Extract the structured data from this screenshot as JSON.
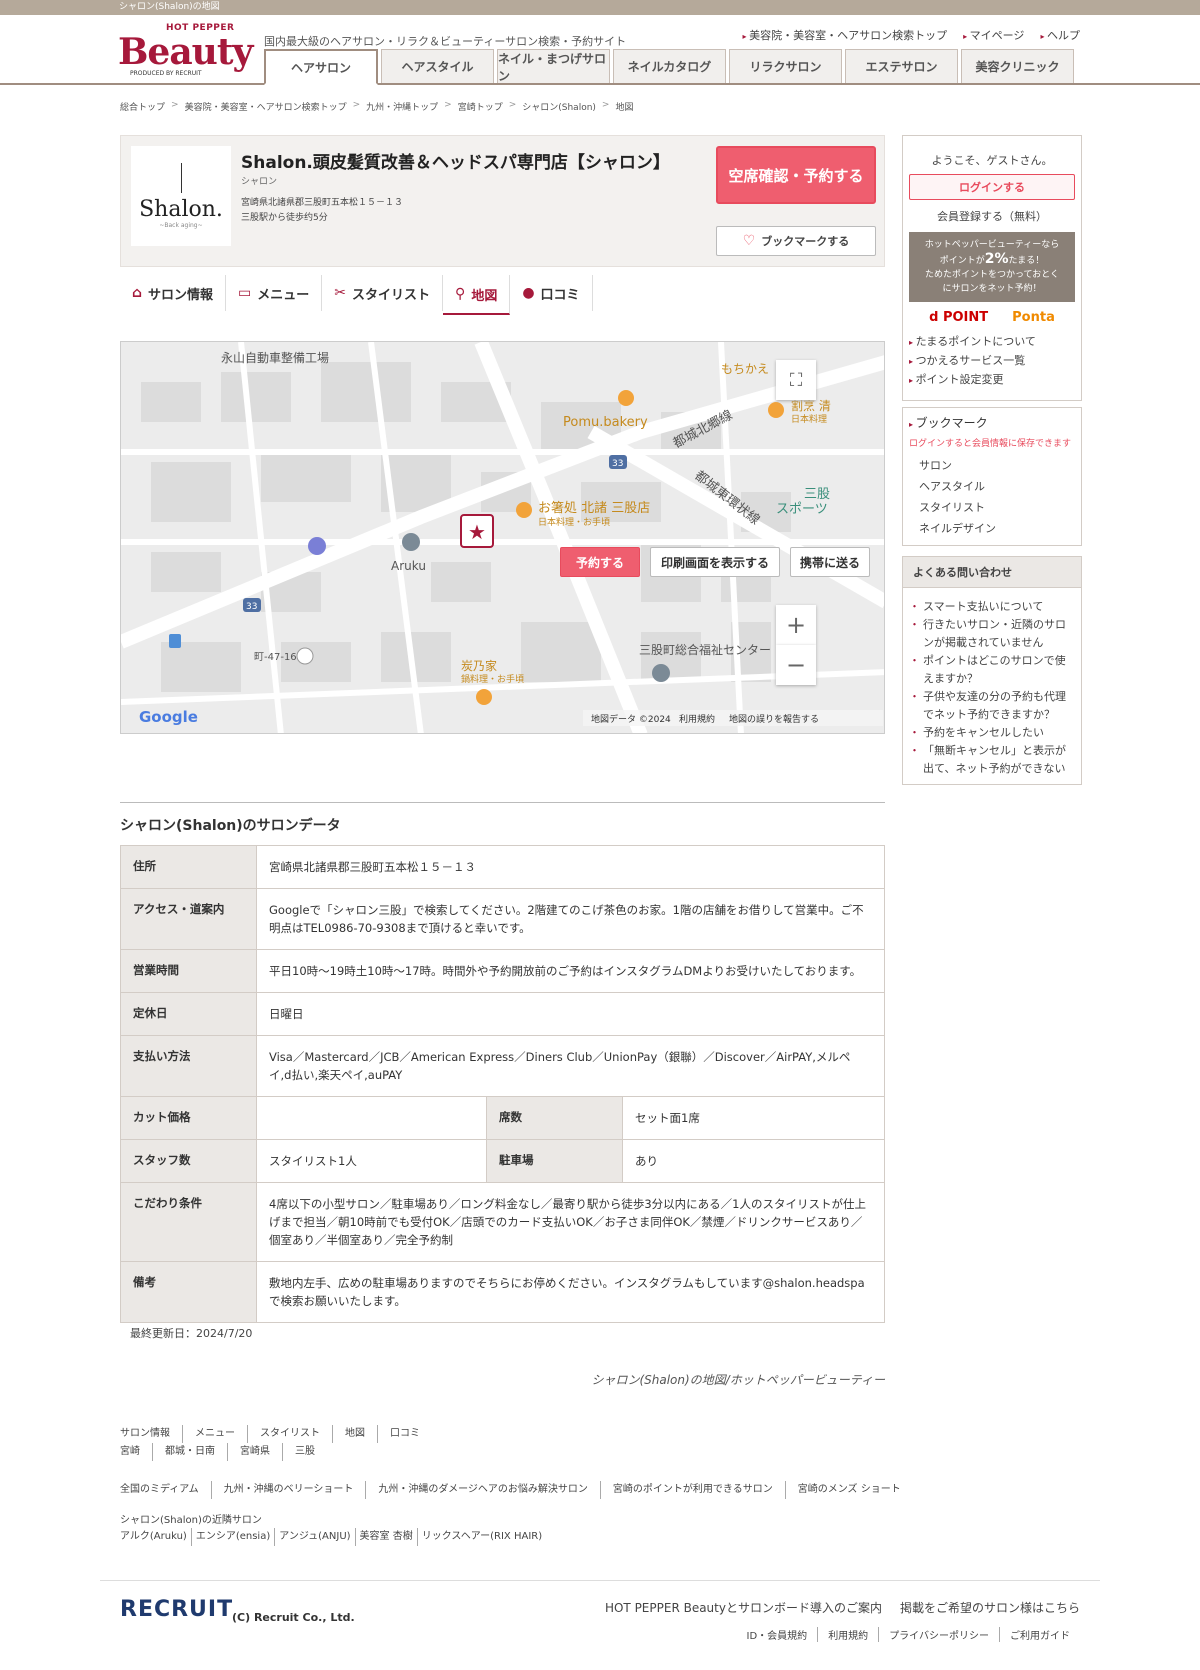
{
  "topbar": {
    "text": "シャロン(Shalon)の地図"
  },
  "header": {
    "logo_top": "HOT PEPPER",
    "logo_main": "Beauty",
    "logo_sub": "PRODUCED BY RECRUIT",
    "tagline": "国内最大級のヘアサロン・リラク＆ビューティーサロン検索・予約サイト",
    "links": [
      "美容院・美容室・ヘアサロン検索トップ",
      "マイページ",
      "ヘルプ"
    ],
    "tabs": [
      "ヘアサロン",
      "ヘアスタイル",
      "ネイル・まつげサロン",
      "ネイルカタログ",
      "リラクサロン",
      "エステサロン",
      "美容クリニック"
    ]
  },
  "breadcrumb": [
    "総合トップ",
    "美容院・美容室・ヘアサロン検索トップ",
    "九州・沖縄トップ",
    "宮崎トップ",
    "シャロン(Shalon)",
    "地図"
  ],
  "salon": {
    "logo_name": "Shalon.",
    "logo_sub": "~Back aging~",
    "name": "Shalon.頭皮髪質改善＆ヘッドスパ専門店【シャロン】",
    "kana": "シャロン",
    "address": "宮崎県北諸県郡三股町五本松１５－１３",
    "access": "三股駅から徒歩约5分",
    "reserve_btn": "空席確認・予約する",
    "bookmark_btn": "ブックマークする"
  },
  "subnav": [
    "サロン情報",
    "メニュー",
    "スタイリスト",
    "地図",
    "口コミ"
  ],
  "map": {
    "labels": {
      "factory": "永山自動車整備工場",
      "mochi": "もちかえ",
      "pomu": "Pomu.bakery",
      "line1": "都城北郷線",
      "kappo": "割烹 清",
      "kappo_sub": "日本料理",
      "route33": "33",
      "osuki": "お箸処 北諸 三股店",
      "osuki_sub": "日本料理・お手頃",
      "line2": "都城東環状線",
      "sports": "三股",
      "sports2": "スポーツ",
      "aruku": "Aruku",
      "machi": "町-47-16",
      "sumino": "炭乃家",
      "sumino_sub": "鍋料理・お手頃",
      "fukushi": "三股町総合福祉センター"
    },
    "google": "Google",
    "attribution": [
      "地図データ ©2024",
      "利用規約",
      "地図の誤りを報告する"
    ]
  },
  "map_buttons": {
    "reserve": "予約する",
    "print": "印刷画面を表示する",
    "mobile": "携帯に送る"
  },
  "data_title": "シャロン(Shalon)のサロンデータ",
  "table": {
    "address_label": "住所",
    "address": "宮崎県北諸県郡三股町五本松１５－１３",
    "access_label": "アクセス・道案内",
    "access": "Googleで「シャロン三股」で検索してください。2階建てのこげ茶色のお家。1階の店舗をお借りして営業中。ご不明点はTEL0986-70-9308まで頂けると幸いです。",
    "hours_label": "営業時間",
    "hours": "平日10時～19時土10時～17時。時間外や予約開放前のご予約はインスタグラムDMよりお受けいたしております。",
    "closed_label": "定休日",
    "closed": "日曜日",
    "payment_label": "支払い方法",
    "payment": "Visa／Mastercard／JCB／American Express／Diners Club／UnionPay（銀聯）／Discover／AirPAY,メルペイ,d払い,楽天ペイ,auPAY",
    "cut_label": "カット価格",
    "cut": "",
    "seats_label": "席数",
    "seats": "セット面1席",
    "staff_label": "スタッフ数",
    "staff": "スタイリスト1人",
    "parking_label": "駐車場",
    "parking": "あり",
    "features_label": "こだわり条件",
    "features": "4席以下の小型サロン／駐車場あり／ロング料金なし／最寄り駅から徒歩3分以内にある／1人のスタイリストが仕上げまで担当／朝10時前でも受付OK／店頭でのカード支払いOK／お子さま同伴OK／禁煙／ドリンクサービスあり／個室あり／半個室あり／完全予約制",
    "notes_label": "備考",
    "notes": "敷地内左手、広めの駐車場ありますのでそちらにお停めください。インスタグラムもしています@shalon.headspa で検索お願いいたします。"
  },
  "updated": "最終更新日：2024/7/20",
  "credit": "シャロン(Shalon)の地図/ホットペッパービューティー",
  "sidebar": {
    "welcome": "ようこそ、ゲストさん。",
    "login": "ログインする",
    "register": "会員登録する（無料）",
    "point_line1": "ホットペッパービューティーなら",
    "point_line2a": "ポイントが",
    "point_pct": "2%",
    "point_line2b": "たまる！",
    "point_line3": "ためたポイントをつかっておとく",
    "point_line4": "にサロンをネット予約！",
    "dpoint": "d POINT",
    "ponta": "Ponta",
    "point_links": [
      "たまるポイントについて",
      "つかえるサービス一覧",
      "ポイント設定変更"
    ],
    "bookmark_title": "ブックマーク",
    "bookmark_note": "ログインすると会員情報に保存できます",
    "bookmark_items": [
      "サロン",
      "ヘアスタイル",
      "スタイリスト",
      "ネイルデザイン"
    ],
    "faq_title": "よくある問い合わせ",
    "faq": [
      "スマート支払いについて",
      "行きたいサロン・近隣のサロンが掲載されていません",
      "ポイントはどこのサロンで使えますか？",
      "子供や友達の分の予約も代理でネット予約できますか？",
      "予約をキャンセルしたい",
      "「無断キャンセル」と表示が出て、ネット予約ができない"
    ]
  },
  "footer": {
    "row1": [
      "サロン情報",
      "メニュー",
      "スタイリスト",
      "地図",
      "口コミ"
    ],
    "row2": [
      "宮崎",
      "都城・日南",
      "宮崎県",
      "三股"
    ],
    "row3": [
      "全国のミディアム",
      "九州・沖縄のベリーショート",
      "九州・沖縄のダメージヘアのお悩み解決サロン",
      "宮崎のポイントが利用できるサロン",
      "宮崎のメンズ ショート"
    ],
    "near_title": "シャロン(Shalon)の近隣サロン",
    "near": [
      "アルク(Aruku)",
      "エンシア(ensia)",
      "アンジュ(ANJU)",
      "美容室 杏樹",
      "リックスヘアー(RIX HAIR)"
    ]
  },
  "bottom": {
    "recruit": "RECRUIT",
    "copyright": "(C) Recruit Co., Ltd.",
    "links1": [
      "HOT PEPPER Beautyとサロンボード導入のご案内",
      "掲載をご希望のサロン様はこちら"
    ],
    "links2": [
      "ID・会員規約",
      "利用規約",
      "プライバシーポリシー",
      "ご利用ガイド"
    ]
  },
  "colors": {
    "brand": "#a6193b",
    "button": "#ef5e6f",
    "header_line": "#a08d80"
  }
}
